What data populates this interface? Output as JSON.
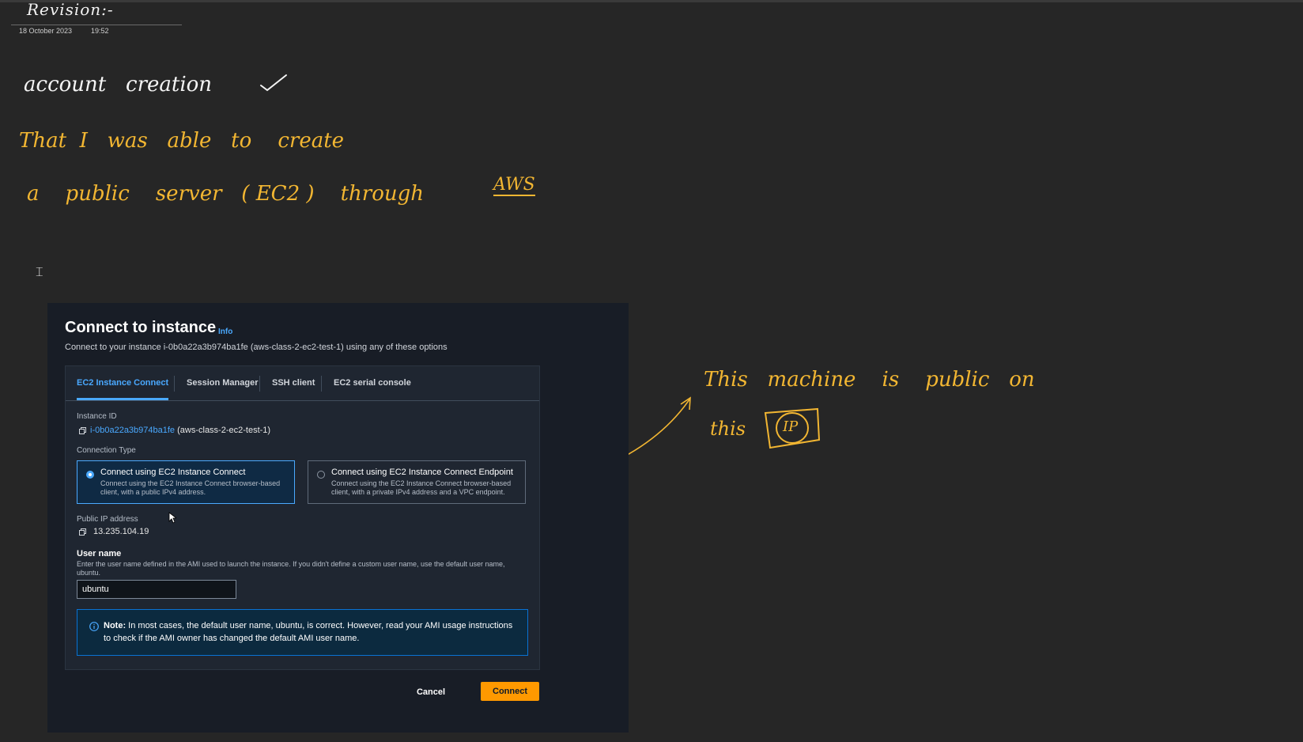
{
  "notebook": {
    "page_title": "Revision:-",
    "date": "18 October 2023",
    "time": "19:52",
    "handwriting": {
      "line1": "account   creation",
      "line2": "That  I   was   able   to    create",
      "line3": "a    public    server   ( EC2 )    through",
      "line3_underlined": "AWS",
      "note1": "This   machine    is    public   on",
      "note2": "this",
      "boxed": "IP"
    }
  },
  "ec2_dialog": {
    "title": "Connect to instance",
    "info_link": "Info",
    "subtitle": "Connect to your instance i-0b0a22a3b974ba1fe (aws-class-2-ec2-test-1) using any of these options",
    "tabs": [
      {
        "label": "EC2 Instance Connect"
      },
      {
        "label": "Session Manager"
      },
      {
        "label": "SSH client"
      },
      {
        "label": "EC2 serial console"
      }
    ],
    "instance_id_label": "Instance ID",
    "instance_id": "i-0b0a22a3b974ba1fe",
    "instance_name": "(aws-class-2-ec2-test-1)",
    "connection_type_label": "Connection Type",
    "options": [
      {
        "title": "Connect using EC2 Instance Connect",
        "description": "Connect using the EC2 Instance Connect browser-based client, with a public IPv4 address."
      },
      {
        "title": "Connect using EC2 Instance Connect Endpoint",
        "description": "Connect using the EC2 Instance Connect browser-based client, with a private IPv4 address and a VPC endpoint."
      }
    ],
    "public_ip_label": "Public IP address",
    "public_ip": "13.235.104.19",
    "username_label": "User name",
    "username_help": "Enter the user name defined in the AMI used to launch the instance. If you didn't define a custom user name, use the default user name, ubuntu.",
    "username_value": "ubuntu",
    "alert_strong": "Note:",
    "alert_text": "In most cases, the default user name, ubuntu, is correct. However, read your AMI usage instructions to check if the AMI owner has changed the default AMI user name.",
    "cancel_label": "Cancel",
    "connect_label": "Connect"
  },
  "colors": {
    "background": "#262626",
    "ink_yellow": "#f2b632",
    "ink_white": "#f4f4f4",
    "aws_blue": "#4aa9ff",
    "aws_orange": "#ff9900"
  }
}
